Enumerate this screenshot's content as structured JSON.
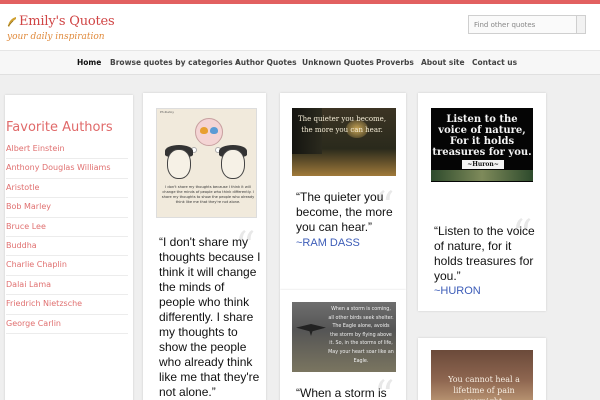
{
  "site": {
    "title": "Emily's Quotes",
    "tagline": "your daily inspiration"
  },
  "search": {
    "placeholder": "Find other quotes"
  },
  "nav": [
    {
      "label": "Home",
      "active": true
    },
    {
      "label": "Browse quotes by categories »"
    },
    {
      "label": "Author Quotes"
    },
    {
      "label": "Unknown Quotes"
    },
    {
      "label": "Proverbs"
    },
    {
      "label": "About site"
    },
    {
      "label": "Contact us"
    }
  ],
  "sidebar": {
    "title": "Favorite Authors",
    "authors": [
      "Albert Einstein",
      "Anthony Douglas Williams",
      "Aristotle",
      "Bob Marley",
      "Bruce Lee",
      "Buddha",
      "Charlie Chaplin",
      "Dalai Lama",
      "Friedrich Nietzsche",
      "George Carlin"
    ]
  },
  "cards": [
    {
      "quote": "“I don't share my thoughts because I think it will change the minds of people who think differently. I share my thoughts to show the people who already think like me that they're not alone.”",
      "image_caption": "I don't share my thoughts because I think it will change the minds of people who think differently. I share my thoughts to show the people who already think like me that they're not alone.",
      "image_small": "Ph.Rudoy"
    },
    {
      "quote": "“The quieter you become, the more you can hear.”",
      "author": "~RAM DASS",
      "image_text": "The quieter you become, the more you can hear."
    },
    {
      "quote": "“Listen to the voice of nature, for it holds treasures for you.”",
      "author": "~HURON",
      "image_text": "Listen to the voice of nature, For it holds treasures for you.",
      "image_author": "~Huron~"
    },
    {
      "quote": "“When a storm is",
      "image_text": "When a storm is coming, all other birds seek shelter. The Eagle alone, avoids the storm by flying above it. So, in the storms of life, May your heart soar like an Eagle."
    },
    {
      "image_text": "You cannot heal a lifetime of pain overnight."
    }
  ],
  "colors": {
    "accent": "#e26060",
    "sidebar_link": "#e07070",
    "author_link": "#3d5db8"
  }
}
